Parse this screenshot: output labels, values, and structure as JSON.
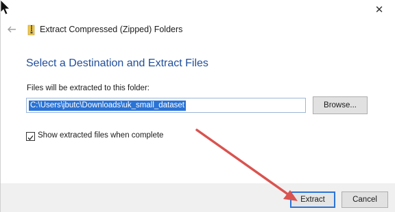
{
  "window": {
    "close_glyph": "✕",
    "title": "Extract Compressed (Zipped) Folders"
  },
  "main": {
    "heading": "Select a Destination and Extract Files",
    "folder_label": "Files will be extracted to this folder:",
    "path_value": "C:\\Users\\jbutc\\Downloads\\uk_small_dataset",
    "browse_label": "Browse...",
    "show_files_label": "Show extracted files when complete",
    "show_files_checked": true
  },
  "footer": {
    "extract_label": "Extract",
    "cancel_label": "Cancel"
  },
  "colors": {
    "heading_blue": "#1f4e9c",
    "selection_blue": "#2a73d6",
    "annotation_arrow_red": "#d9534f"
  },
  "icons": {
    "back": "back-arrow-icon",
    "folder": "zip-folder-icon",
    "close": "close-icon",
    "checkmark": "checkmark-icon",
    "cursor": "mouse-cursor-icon"
  }
}
